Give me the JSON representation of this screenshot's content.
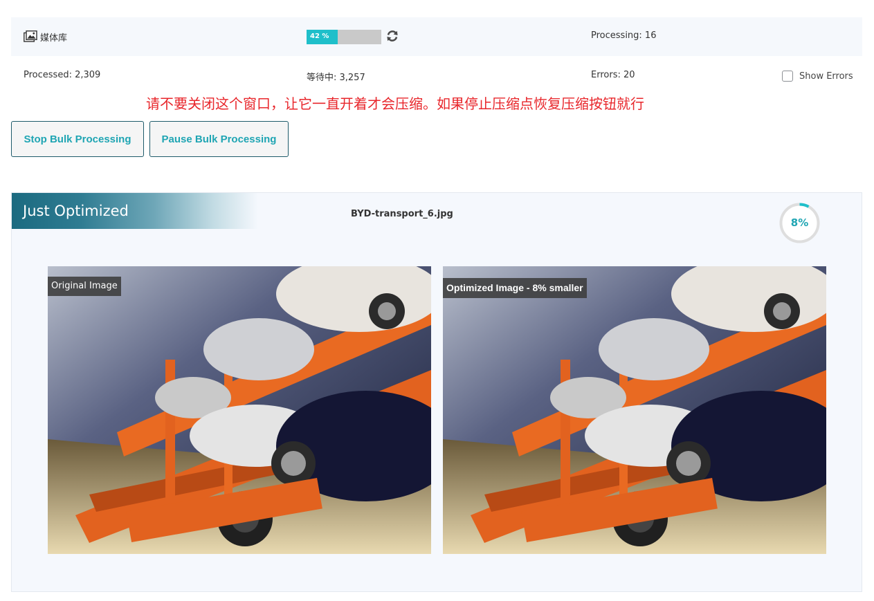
{
  "status": {
    "library_icon": "media-library-icon",
    "library_label": "媒体库",
    "progress_percent": 42,
    "progress_text": "42 %",
    "refresh_icon": "refresh-icon",
    "processing": "Processing: 16"
  },
  "stats": {
    "processed": "Processed: 2,309",
    "waiting": "等待中: 3,257",
    "errors": "Errors: 20",
    "show_errors_label": "Show Errors",
    "show_errors_checked": false
  },
  "warning_text": "请不要关闭这个窗口，让它一直开着才会压缩。如果停止压缩点恢复压缩按钮就行",
  "buttons": {
    "stop": "Stop Bulk Processing",
    "pause": "Pause Bulk Processing"
  },
  "optimized": {
    "title": "Just Optimized",
    "filename": "BYD-transport_6.jpg",
    "reduction_percent": 8,
    "reduction_text": "8%",
    "original_label": "Original Image",
    "optimized_label": "Optimized Image - 8% smaller"
  },
  "colors": {
    "accent": "#1fbfca",
    "accent_text": "#1fa5b3",
    "warning": "#e8262b",
    "header_dark": "#1b6a80"
  }
}
